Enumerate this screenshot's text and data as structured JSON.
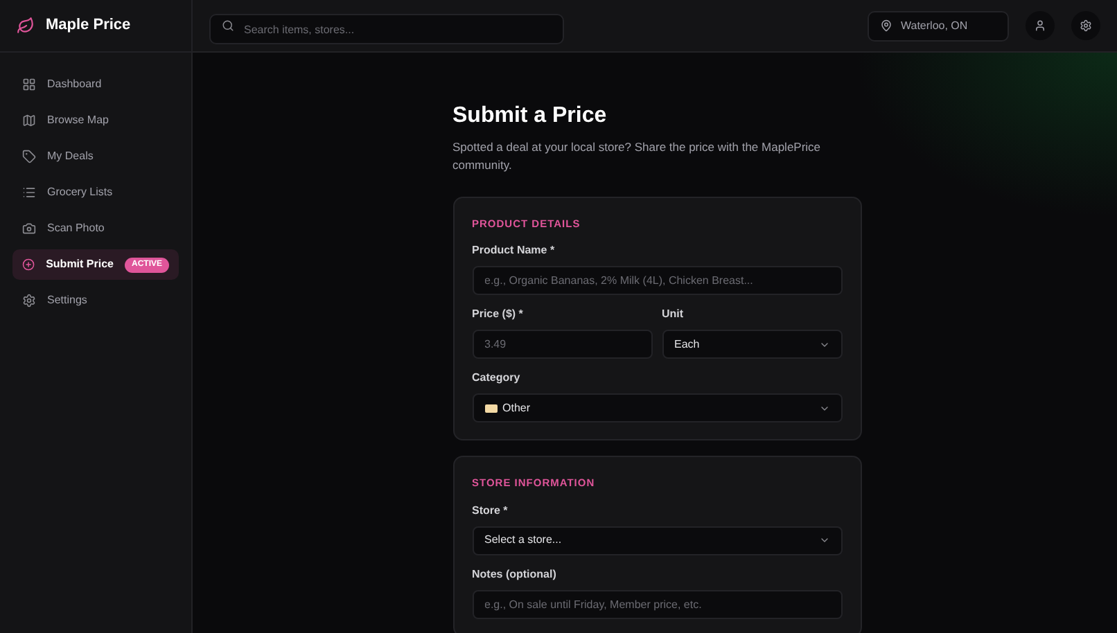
{
  "brand": {
    "name": "Maple Price"
  },
  "sidebar": {
    "items": [
      {
        "label": "Dashboard",
        "selected": false
      },
      {
        "label": "Browse Map",
        "selected": false
      },
      {
        "label": "My Deals",
        "selected": false
      },
      {
        "label": "Grocery Lists",
        "selected": false
      },
      {
        "label": "Scan Photo",
        "selected": false
      },
      {
        "label": "Submit Price",
        "selected": true,
        "badge": "ACTIVE"
      },
      {
        "label": "Settings",
        "selected": false
      }
    ]
  },
  "header": {
    "search": {
      "placeholder": "Search items, stores..."
    },
    "location": "Waterloo, ON"
  },
  "page": {
    "title": "Submit a Price",
    "subtitle": "Spotted a deal at your local store? Share the price with the MaplePrice community.",
    "sections": [
      {
        "title": "PRODUCT DETAILS",
        "rows": [
          [
            {
              "kind": "input",
              "label": "Product Name *",
              "placeholder": "e.g., Organic Bananas, 2% Milk (4L), Chicken Breast..."
            }
          ],
          [
            {
              "kind": "input",
              "label": "Price ($) *",
              "placeholder": "3.49"
            },
            {
              "kind": "select",
              "label": "Unit",
              "value": "Each"
            }
          ],
          [
            {
              "kind": "emoji-select",
              "label": "Category",
              "value": "Other"
            }
          ]
        ]
      },
      {
        "title": "STORE INFORMATION",
        "rows": [
          [
            {
              "kind": "select",
              "label": "Store *",
              "value": "Select a store..."
            }
          ],
          [
            {
              "kind": "input",
              "label": "Notes (optional)",
              "placeholder": "e.g., On sale until Friday, Member price, etc."
            }
          ]
        ]
      }
    ]
  }
}
